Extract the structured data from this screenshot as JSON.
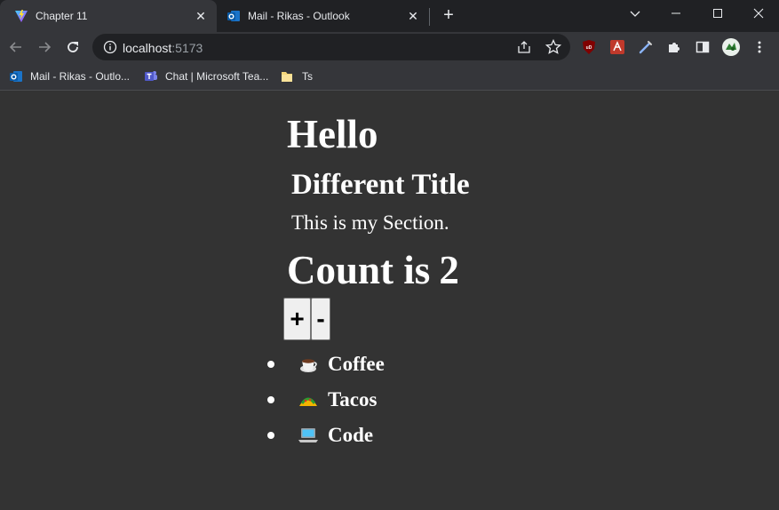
{
  "browser": {
    "tabs": [
      {
        "title": "Chapter 11",
        "icon": "vite-icon",
        "active": true
      },
      {
        "title": "Mail - Rikas - Outlook",
        "icon": "outlook-icon",
        "active": false
      }
    ],
    "new_tab_label": "+",
    "close_glyph": "✕",
    "address": {
      "host": "localhost",
      "port": ":5173"
    },
    "bookmarks": [
      {
        "label": "Mail - Rikas - Outlo...",
        "icon": "outlook-icon"
      },
      {
        "label": "Chat | Microsoft Tea...",
        "icon": "teams-icon"
      },
      {
        "label": "Ts",
        "icon": "folder-icon"
      }
    ]
  },
  "page": {
    "title": "Hello",
    "subtitle": "Different Title",
    "section_text": "This is my Section.",
    "count_prefix": "Count is",
    "count": "2",
    "increment_label": "+",
    "decrement_label": "-",
    "items": [
      {
        "emoji": "coffee-icon",
        "label": "Coffee"
      },
      {
        "emoji": "taco-icon",
        "label": "Tacos"
      },
      {
        "emoji": "laptop-icon",
        "label": "Code"
      }
    ]
  },
  "colors": {
    "page_background": "#333333",
    "tabstrip": "#202124",
    "toolbar": "#35363a",
    "text": "#ffffff"
  }
}
